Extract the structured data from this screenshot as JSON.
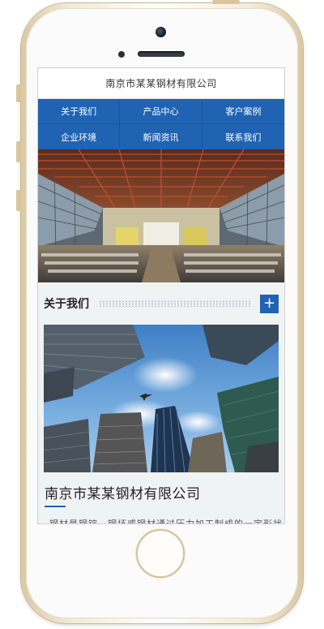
{
  "header": {
    "title": "南京市某某钢材有限公司"
  },
  "nav": {
    "items": [
      {
        "label": "关于我们"
      },
      {
        "label": "产品中心"
      },
      {
        "label": "客户案例"
      },
      {
        "label": "企业环境"
      },
      {
        "label": "新闻资讯"
      },
      {
        "label": "联系我们"
      }
    ]
  },
  "about": {
    "title": "关于我们",
    "more_icon": "+",
    "company_name": "南京市某某钢材有限公司",
    "intro": "钢材是钢锭、钢坯或钢材通过压力加工制成的一定形状"
  },
  "colors": {
    "accent": "#2063b3",
    "section_bg": "#f0f3f3",
    "phone_frame": "#d9c9a5"
  }
}
